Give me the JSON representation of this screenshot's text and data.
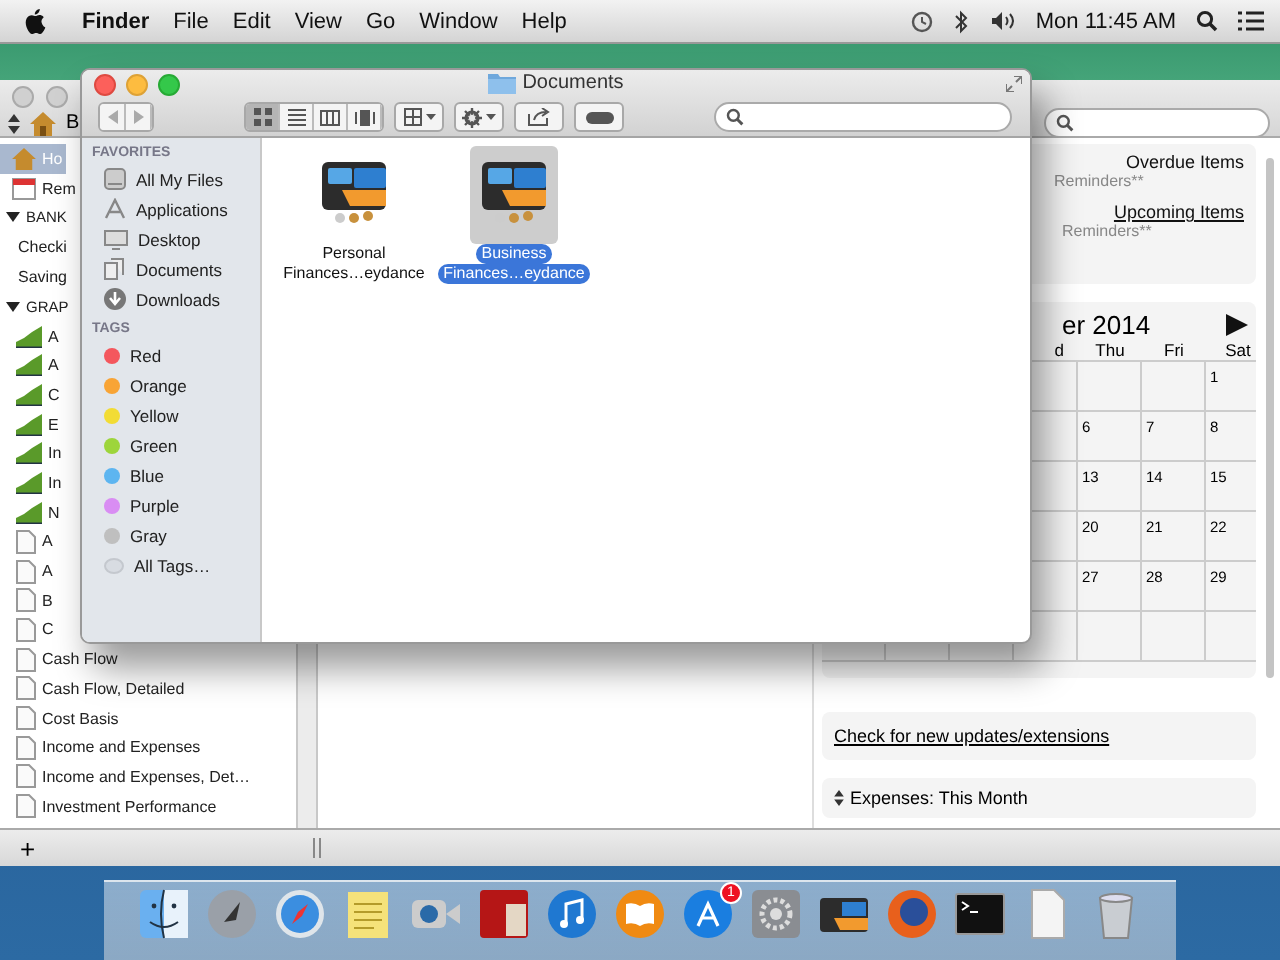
{
  "menu_bar": {
    "app_name": "Finder",
    "menus": [
      "File",
      "Edit",
      "View",
      "Go",
      "Window",
      "Help"
    ],
    "clock": "Mon 11:45 AM"
  },
  "main_window": {
    "toolbar_label": "B",
    "sidebar": [
      {
        "kind": "home",
        "label": "Ho",
        "selected": true
      },
      {
        "kind": "reminders",
        "label": "Rem",
        "selected": false
      },
      {
        "kind": "section",
        "label": "BANK",
        "expanded": true,
        "selected": false,
        "children": [
          {
            "kind": "account",
            "label": "Checki",
            "selected": false
          },
          {
            "kind": "account",
            "label": "Saving",
            "selected": false
          }
        ]
      },
      {
        "kind": "section",
        "label": "GRAP",
        "expanded": true,
        "selected": false,
        "children": [
          {
            "kind": "graph",
            "label": "A",
            "selected": false
          },
          {
            "kind": "graph",
            "label": "A",
            "selected": false
          },
          {
            "kind": "graph",
            "label": "C",
            "selected": false
          },
          {
            "kind": "graph",
            "label": "E",
            "selected": false
          },
          {
            "kind": "graph",
            "label": "In",
            "selected": false
          },
          {
            "kind": "graph",
            "label": "In",
            "selected": false
          },
          {
            "kind": "graph",
            "label": "N",
            "selected": false
          },
          {
            "kind": "report",
            "label": "A",
            "selected": false
          },
          {
            "kind": "report",
            "label": "A",
            "selected": false
          },
          {
            "kind": "report",
            "label": "B",
            "selected": false
          },
          {
            "kind": "report",
            "label": "C",
            "selected": false
          },
          {
            "kind": "report",
            "label": "Cash Flow",
            "selected": false
          },
          {
            "kind": "report",
            "label": "Cash Flow, Detailed",
            "selected": false
          },
          {
            "kind": "report",
            "label": "Cost Basis",
            "selected": false
          },
          {
            "kind": "report",
            "label": "Income and Expenses",
            "selected": false
          },
          {
            "kind": "report",
            "label": "Income and Expenses, Det…",
            "selected": false
          },
          {
            "kind": "report",
            "label": "Investment Performance",
            "selected": false
          }
        ]
      }
    ],
    "add_button": "+",
    "reminders": [
      {
        "title": "Overdue Items",
        "underlined": false,
        "note": "Reminders**"
      },
      {
        "title": "Upcoming Items",
        "underlined": true,
        "note": "Reminders**"
      }
    ],
    "calendar": {
      "month": "er 2014",
      "day_headers": [
        "d",
        "Thu",
        "Fri",
        "Sat"
      ],
      "weeks": [
        [
          "1"
        ],
        [
          "6",
          "7",
          "8"
        ],
        [
          "13",
          "14",
          "15"
        ],
        [
          "20",
          "21",
          "22"
        ],
        [
          "27",
          "28",
          "29"
        ]
      ]
    },
    "updates_link": "Check for new updates/extensions",
    "expenses_title": "Expenses: This Month"
  },
  "finder": {
    "title": "Documents",
    "views": [
      {
        "kind": "icons",
        "selected": true
      },
      {
        "kind": "list",
        "selected": false
      },
      {
        "kind": "columns",
        "selected": false
      },
      {
        "kind": "coverflow",
        "selected": false
      }
    ],
    "favorites_heading": "FAVORITES",
    "favorites": [
      {
        "kind": "files",
        "label": "All My Files"
      },
      {
        "kind": "applications",
        "label": "Applications"
      },
      {
        "kind": "desktop",
        "label": "Desktop"
      },
      {
        "kind": "documents",
        "label": "Documents"
      },
      {
        "kind": "downloads",
        "label": "Downloads"
      }
    ],
    "tags_heading": "TAGS",
    "tags": [
      {
        "kind": "tag",
        "label": "Red",
        "color": "#f4575d"
      },
      {
        "kind": "tag",
        "label": "Orange",
        "color": "#f8a435"
      },
      {
        "kind": "tag",
        "label": "Yellow",
        "color": "#f2dc34"
      },
      {
        "kind": "tag",
        "label": "Green",
        "color": "#9dd53b"
      },
      {
        "kind": "tag",
        "label": "Blue",
        "color": "#5db5f0"
      },
      {
        "kind": "tag",
        "label": "Purple",
        "color": "#d98df3"
      },
      {
        "kind": "tag",
        "label": "Gray",
        "color": "#bfbfbf"
      },
      {
        "kind": "all",
        "label": "All Tags…"
      }
    ],
    "files": [
      {
        "lines": [
          "Personal",
          "Finances…eydance"
        ],
        "selected": false
      },
      {
        "lines": [
          "Business",
          "Finances…eydance"
        ],
        "selected": true
      }
    ]
  },
  "dock": {
    "items": [
      {
        "kind": "finder"
      },
      {
        "kind": "launchpad"
      },
      {
        "kind": "safari"
      },
      {
        "kind": "notes"
      },
      {
        "kind": "facetime"
      },
      {
        "kind": "photobooth"
      },
      {
        "kind": "itunes"
      },
      {
        "kind": "ibooks"
      },
      {
        "kind": "appstore",
        "badge": "1"
      },
      {
        "kind": "prefs"
      },
      {
        "kind": "wallet"
      },
      {
        "kind": "firefox"
      },
      {
        "kind": "terminal"
      },
      {
        "kind": "document"
      },
      {
        "kind": "trash"
      }
    ]
  }
}
